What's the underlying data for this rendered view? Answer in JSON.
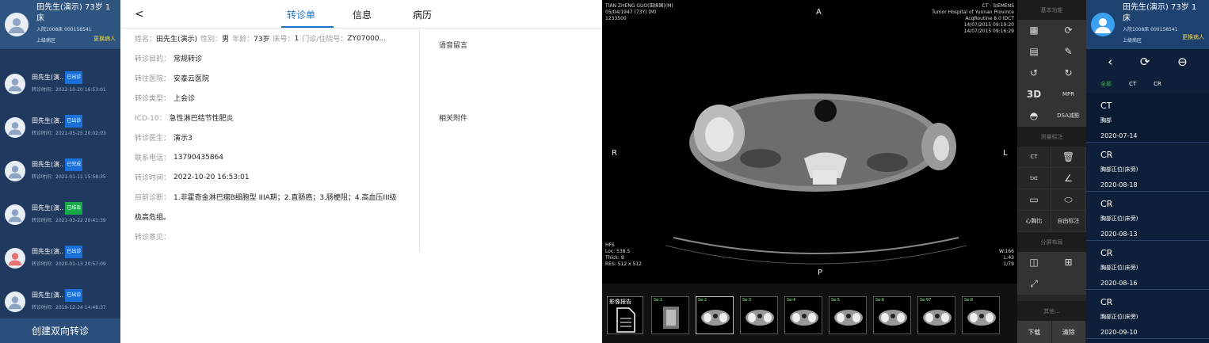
{
  "left_panel": {
    "current": {
      "name": "田先生(演示) 73岁 1床",
      "line2": "入院1008床 000158541",
      "line3": "上级病区",
      "switch_label": "更换病人"
    },
    "patients": [
      {
        "name": "田先生(演..",
        "badge": "已出诊",
        "badge_color": "#1a6fd8",
        "time": "转诊时间：2022-10-20 16:53:01"
      },
      {
        "name": "田先生(演..",
        "badge": "已出诊",
        "badge_color": "#1a6fd8",
        "time": "转诊时间：2021-05-25 20:02:03"
      },
      {
        "name": "田先生(演..",
        "badge": "已完成",
        "badge_color": "#1a6fd8",
        "time": "转诊时间：2021-01-11 15:58:35"
      },
      {
        "name": "田先生(演..",
        "badge": "已结束",
        "badge_color": "#18a84a",
        "time": "转诊时间：2021-03-22 20:41:39"
      },
      {
        "name": "田先生(演..",
        "badge": "已出诊",
        "badge_color": "#1a6fd8",
        "time": "转诊时间：2020-01-13 20:57:09"
      },
      {
        "name": "田先生(演..",
        "badge": "已出诊",
        "badge_color": "#1a6fd8",
        "time": "转诊时间：2019-12-24 14:48:37"
      }
    ],
    "create_label": "创建双向转诊"
  },
  "middle": {
    "back": "<",
    "tabs": [
      "转诊单",
      "信息",
      "病历"
    ],
    "active_tab": 0,
    "patient_line": {
      "l_name": "姓名：",
      "name": "田先生(演示)",
      "l_sex": "性别：",
      "sex": "男",
      "l_age": "年龄：",
      "age": "73岁",
      "l_bed": "床号：",
      "bed": "1",
      "l_no": "门诊/住院号：",
      "no": "ZY07000..."
    },
    "fields": [
      {
        "label": "转诊目的：",
        "value": "常规转诊"
      },
      {
        "label": "转往医院：",
        "value": "安泰云医院"
      },
      {
        "label": "转诊类型：",
        "value": "上会诊"
      },
      {
        "label": "ICD-10：",
        "value": "急性淋巴结节性肥炎"
      },
      {
        "label": "转诊医生：",
        "value": "演示3"
      },
      {
        "label": "联系电话：",
        "value": "13790435864"
      },
      {
        "label": "转诊时间：",
        "value": "2022-10-20 16:53:01"
      },
      {
        "label": "目前诊断：",
        "value": "1.非霍奇金淋巴瘤B细胞型 IIIA期；2.直肠癌；3.肠梗阻；4.高血压III级"
      },
      {
        "label": "",
        "value": "极高危组。"
      },
      {
        "label": "转诊意见：",
        "value": ""
      }
    ],
    "voice_label": "语音留言",
    "attach_label": "相关附件"
  },
  "viewer": {
    "overlay_tl": [
      "TIAN ZHENG GUO(田振国)(M)",
      "05/04/1947 (73Y) (M)",
      "1233500"
    ],
    "overlay_tr": [
      "CT - SIEMENS",
      "Tumor Hospital of Yunnan Province",
      "AcqRoutine 8.0 IDCT",
      "14/07/2015 09:19:20",
      "14/07/2015 09:16:29"
    ],
    "overlay_bl": [
      "HFS",
      "Loc: 538.5",
      "Thick: 8",
      "RES: 512 x 512"
    ],
    "overlay_br": [
      "W:166",
      "L:43",
      "1/79"
    ],
    "orient": {
      "top": "A",
      "bottom": "P",
      "left": "R",
      "right": "L"
    },
    "report_label": "影像报告",
    "thumbs": [
      "Se:1",
      "Se:2",
      "Se:3",
      "Se:4",
      "Se:5",
      "Se:6",
      "Se:97",
      "Se:8"
    ]
  },
  "tools": {
    "sections": [
      "基本功能",
      "测量标注",
      "分屏布局",
      "其他..."
    ],
    "row1": [
      {
        "icon": "grid-icon",
        "g": "▦"
      },
      {
        "icon": "refresh-icon",
        "g": "⟳"
      }
    ],
    "row2": [
      {
        "icon": "layout-icon",
        "g": "▤"
      },
      {
        "icon": "pencil-icon",
        "g": "✎"
      }
    ],
    "row3": [
      {
        "icon": "rotate-left-icon",
        "g": "↺"
      },
      {
        "icon": "rotate-right-icon",
        "g": "↻"
      }
    ],
    "row4": [
      {
        "label": "3D"
      },
      {
        "label": "MPR"
      }
    ],
    "row5": [
      {
        "icon": "half-circle-icon",
        "g": "◓"
      },
      {
        "label": "DSA减影"
      }
    ],
    "meas1": [
      {
        "label": "CT"
      },
      {
        "icon": "trash-icon",
        "g": "🗑"
      }
    ],
    "meas2": [
      {
        "label": "txt"
      },
      {
        "icon": "angle-icon",
        "g": "∠"
      }
    ],
    "meas3": [
      {
        "icon": "rectangle-icon",
        "g": "▭"
      },
      {
        "icon": "ellipse-icon",
        "g": "⬭"
      }
    ],
    "meas4": [
      {
        "label": "心胸比"
      },
      {
        "label": "自由标注"
      }
    ],
    "split1": [
      {
        "icon": "split-two-icon",
        "g": "◫"
      },
      {
        "icon": "split-four-icon",
        "g": "⊞"
      }
    ],
    "split2": [
      {
        "icon": "fullscreen-icon",
        "g": "⤢"
      },
      {
        "label": ""
      }
    ],
    "bottom": [
      "下载",
      "清除"
    ]
  },
  "right_panel": {
    "current": {
      "name": "田先生(演示) 73岁 1床",
      "line2": "入院1008床 000158541",
      "line3": "上级病区",
      "switch_label": "更换病人"
    },
    "toolbar": [
      "‹",
      "⟳",
      "⊖"
    ],
    "filter_tabs": [
      "全部",
      "CT",
      "CR"
    ],
    "studies": [
      {
        "modality": "CT",
        "part": "胸部",
        "date": "2020-07-14"
      },
      {
        "modality": "CR",
        "part": "胸部正位(床旁)",
        "date": "2020-08-18"
      },
      {
        "modality": "CR",
        "part": "胸部正位(床旁)",
        "date": "2020-08-13"
      },
      {
        "modality": "CR",
        "part": "胸部正位(床旁)",
        "date": "2020-08-16"
      },
      {
        "modality": "CR",
        "part": "胸部正位(床旁)",
        "date": "2020-09-10"
      }
    ]
  }
}
